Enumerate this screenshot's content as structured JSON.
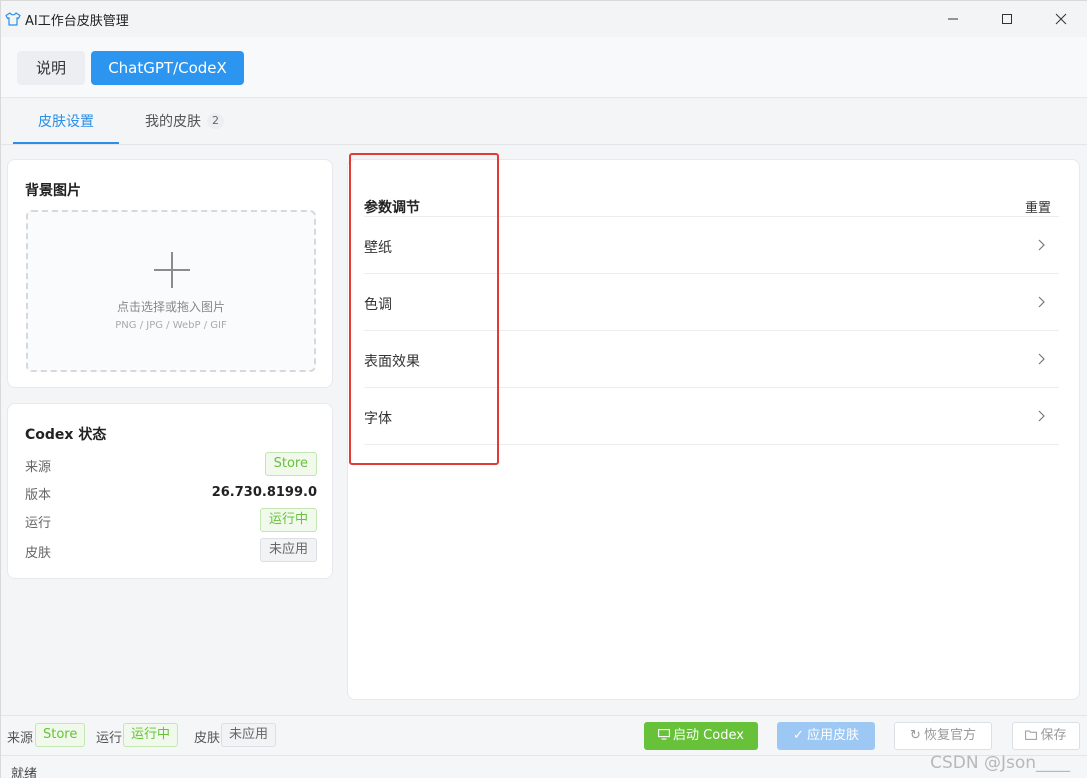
{
  "window": {
    "title": "AI工作台皮肤管理"
  },
  "top_tabs": [
    {
      "label": "说明"
    },
    {
      "label": "ChatGPT/CodeX"
    }
  ],
  "sub_tabs": {
    "skin_settings": "皮肤设置",
    "my_skins": "我的皮肤",
    "my_skins_count": "2"
  },
  "background_card": {
    "title": "背景图片",
    "drop_text": "点击选择或拖入图片",
    "formats": "PNG / JPG / WebP / GIF"
  },
  "status_card": {
    "title": "Codex 状态",
    "rows": [
      {
        "label": "来源",
        "value": "Store"
      },
      {
        "label": "版本",
        "value": "26.730.8199.0"
      },
      {
        "label": "运行",
        "value": "运行中"
      },
      {
        "label": "皮肤",
        "value": "未应用"
      }
    ]
  },
  "param_card": {
    "title": "参数调节",
    "reset": "重置",
    "items": [
      {
        "label": "壁纸"
      },
      {
        "label": "色调"
      },
      {
        "label": "表面效果"
      },
      {
        "label": "字体"
      }
    ]
  },
  "bottom_bar": {
    "source_label": "来源",
    "source_value": "Store",
    "run_label": "运行",
    "run_value": "运行中",
    "skin_label": "皮肤",
    "skin_value": "未应用",
    "launch": "启动 Codex",
    "apply": "应用皮肤",
    "restore": "恢复官方",
    "save": "保存"
  },
  "statusline": {
    "ready": "就绪",
    "watermark": "CSDN @Json____"
  },
  "colors": {
    "accent_blue": "#2b95f0",
    "success_green": "#67c23a",
    "highlight_red": "#e53935"
  }
}
